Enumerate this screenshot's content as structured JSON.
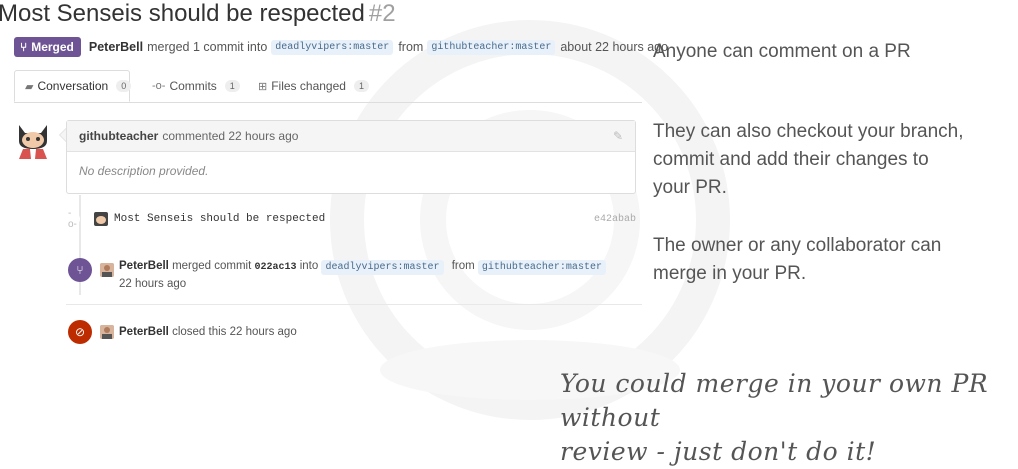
{
  "pr": {
    "title": "Most Senseis should be respected",
    "number": "#2",
    "badge": "Merged",
    "author": "PeterBell",
    "merge_text": "merged 1 commit into",
    "base_branch": "deadlyvipers:master",
    "from_text": "from",
    "head_branch": "githubteacher:master",
    "time": "about 22 hours ago"
  },
  "tabs": [
    {
      "label": "Conversation",
      "count": "0"
    },
    {
      "label": "Commits",
      "count": "1"
    },
    {
      "label": "Files changed",
      "count": "1"
    }
  ],
  "comment": {
    "user": "githubteacher",
    "action": "commented 22 hours ago",
    "body": "No description provided."
  },
  "commit": {
    "message": "Most Senseis should be respected",
    "sha": "e42abab"
  },
  "merge_event": {
    "user": "PeterBell",
    "text1": "merged commit",
    "sha": "022ac13",
    "text2": "into",
    "base_branch": "deadlyvipers:master",
    "text3": "from",
    "head_branch": "githubteacher:master",
    "time": "22 hours ago"
  },
  "close_event": {
    "user": "PeterBell",
    "text": "closed this 22 hours ago"
  },
  "notes": {
    "n1": "Anyone can comment on a PR",
    "n2a": "They can also checkout your branch,",
    "n2b": "commit and add their changes to",
    "n2c": "your PR.",
    "n3a": "The owner or any collaborator can",
    "n3b": "merge in your PR.",
    "hand1": "You could merge in your own PR without",
    "hand2": "review - just don't do it!"
  },
  "colors": {
    "merged": "#6e5494",
    "closed": "#bd2c00",
    "branch_bg": "#e8f1fa"
  }
}
